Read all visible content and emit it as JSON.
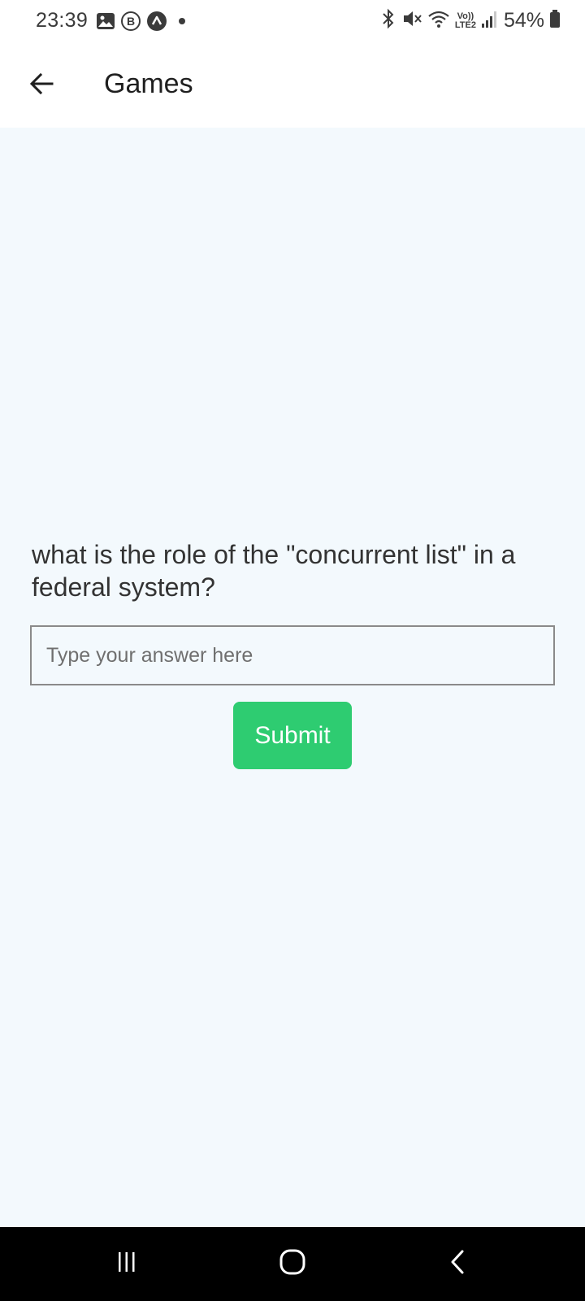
{
  "status_bar": {
    "time": "23:39",
    "left_icons": [
      "gallery-icon",
      "b-badge-icon",
      "caret-up-badge-icon",
      "dot-icon"
    ],
    "right_icons": [
      "bluetooth-icon",
      "mute-icon",
      "wifi-icon",
      "volte-icon",
      "signal-icon",
      "battery-icon"
    ],
    "lte_top": "Vo))",
    "lte_bottom": "LTE2",
    "battery": "54%"
  },
  "app_bar": {
    "title": "Games",
    "back_icon": "arrow-left-icon"
  },
  "main": {
    "question": "what is the role of the \"concurrent list\" in a federal system?",
    "answer_value": "",
    "answer_placeholder": "Type your answer here",
    "submit_label": "Submit"
  },
  "nav_bar": {
    "icons": [
      "recent-apps-icon",
      "home-icon",
      "back-nav-icon"
    ]
  },
  "colors": {
    "content_background": "#f3f9fd",
    "submit_button": "#2ecc71",
    "nav_bar": "#000000"
  }
}
